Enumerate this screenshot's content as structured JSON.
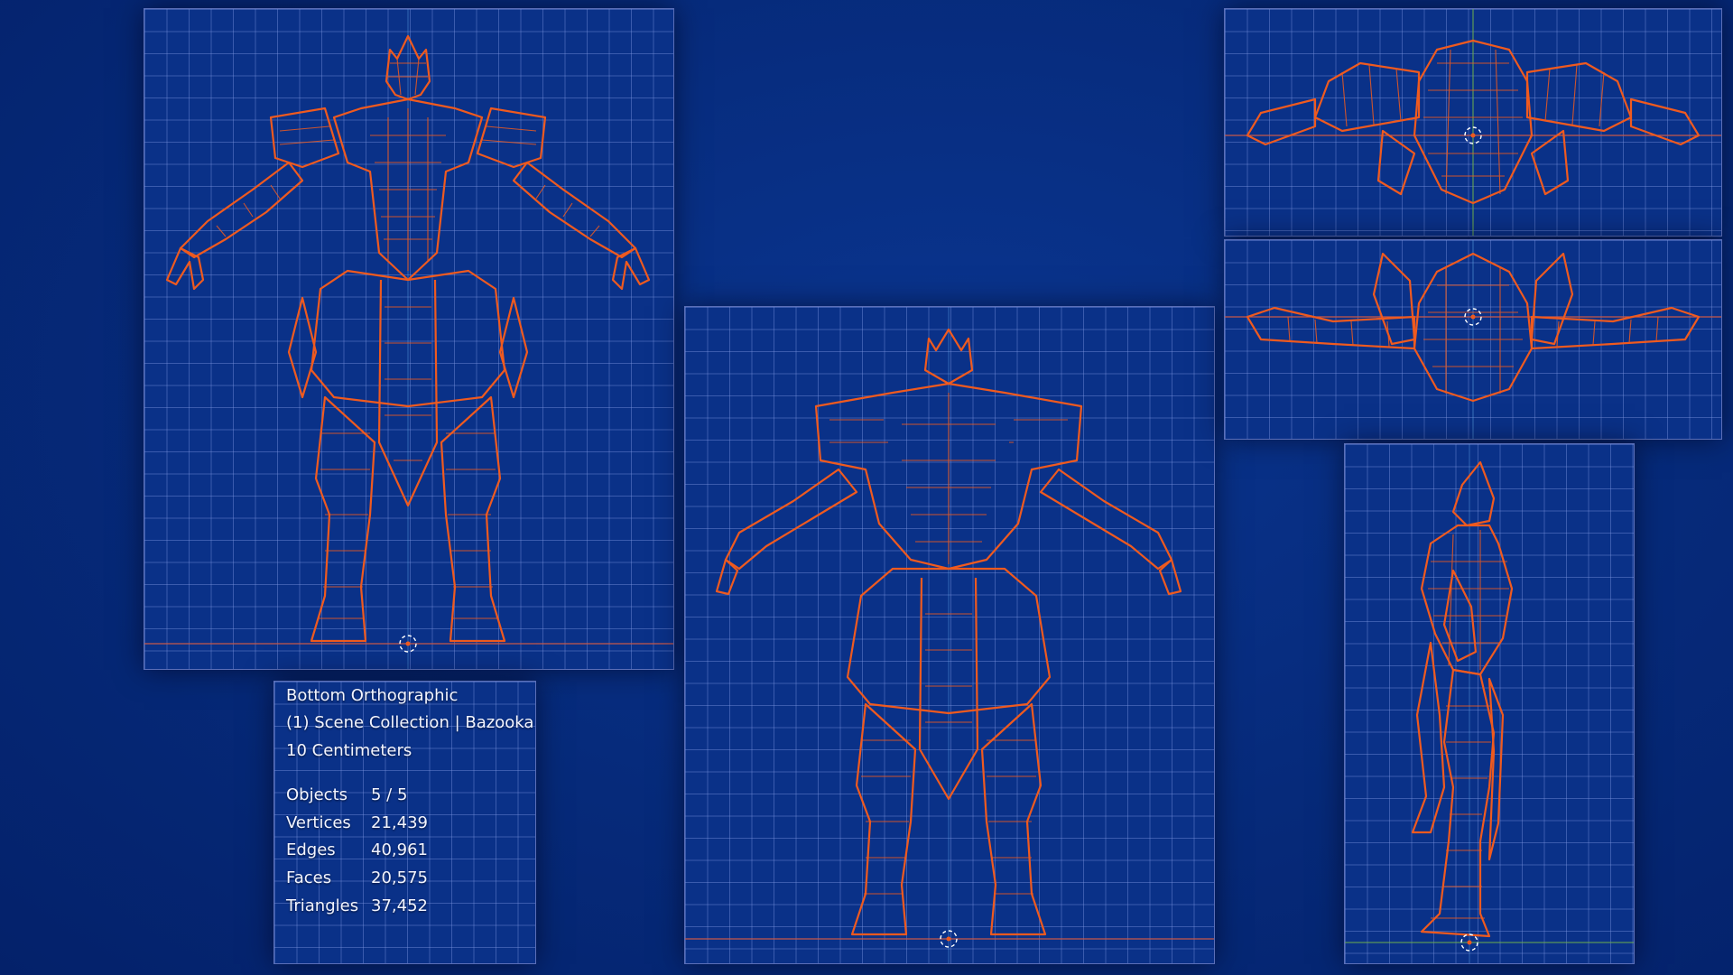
{
  "overlay": {
    "view_name": "Bottom Orthographic",
    "collection": "(1) Scene Collection | Bazooka",
    "grid_scale": "10 Centimeters",
    "stats": [
      {
        "label": "Objects",
        "value": "5 / 5"
      },
      {
        "label": "Vertices",
        "value": "21,439"
      },
      {
        "label": "Edges",
        "value": "40,961"
      },
      {
        "label": "Faces",
        "value": "20,575"
      },
      {
        "label": "Triangles",
        "value": "37,452"
      }
    ]
  },
  "viewports": [
    {
      "name": "front-view"
    },
    {
      "name": "back-view"
    },
    {
      "name": "top-view"
    },
    {
      "name": "bottom-view"
    },
    {
      "name": "side-view"
    }
  ],
  "colors": {
    "background": "#062a7a",
    "grid": "#7d96e1",
    "wireframe": "#ef5a1f",
    "text": "#f2f4ff"
  },
  "icons": [
    "3d-cursor-icon"
  ]
}
